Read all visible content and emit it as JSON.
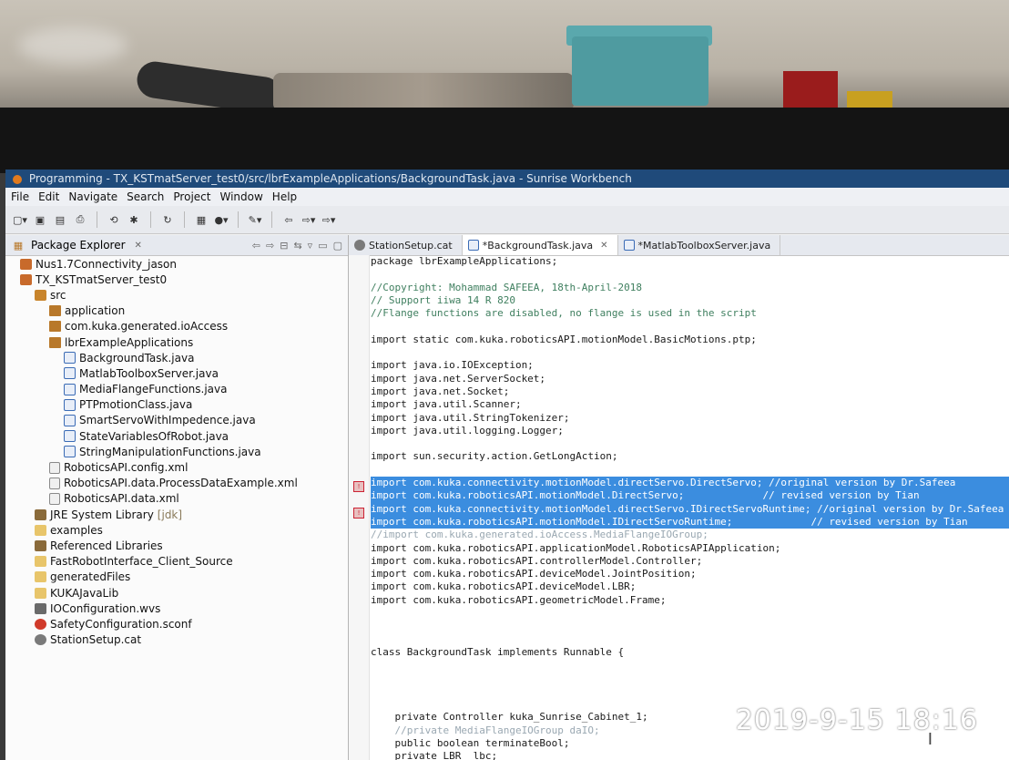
{
  "window": {
    "title": "Programming - TX_KSTmatServer_test0/src/lbrExampleApplications/BackgroundTask.java - Sunrise Workbench"
  },
  "menu": [
    "File",
    "Edit",
    "Navigate",
    "Search",
    "Project",
    "Window",
    "Help"
  ],
  "explorer": {
    "title": "Package Explorer",
    "items": [
      {
        "label": "Nus1.7Connectivity_jason",
        "indent": 1,
        "icon": "project-icon"
      },
      {
        "label": "TX_KSTmatServer_test0",
        "indent": 1,
        "icon": "project-icon"
      },
      {
        "label": "src",
        "indent": 2,
        "icon": "src-folder-icon"
      },
      {
        "label": "application",
        "indent": 3,
        "icon": "package-icon"
      },
      {
        "label": "com.kuka.generated.ioAccess",
        "indent": 3,
        "icon": "package-icon"
      },
      {
        "label": "lbrExampleApplications",
        "indent": 3,
        "icon": "package-icon"
      },
      {
        "label": "BackgroundTask.java",
        "indent": 4,
        "icon": "java-file-icon"
      },
      {
        "label": "MatlabToolboxServer.java",
        "indent": 4,
        "icon": "java-file-icon"
      },
      {
        "label": "MediaFlangeFunctions.java",
        "indent": 4,
        "icon": "java-file-icon"
      },
      {
        "label": "PTPmotionClass.java",
        "indent": 4,
        "icon": "java-file-icon"
      },
      {
        "label": "SmartServoWithImpedence.java",
        "indent": 4,
        "icon": "java-file-icon"
      },
      {
        "label": "StateVariablesOfRobot.java",
        "indent": 4,
        "icon": "java-file-icon"
      },
      {
        "label": "StringManipulationFunctions.java",
        "indent": 4,
        "icon": "java-file-icon"
      },
      {
        "label": "RoboticsAPI.config.xml",
        "indent": 3,
        "icon": "xml-file-icon"
      },
      {
        "label": "RoboticsAPI.data.ProcessDataExample.xml",
        "indent": 3,
        "icon": "xml-file-icon"
      },
      {
        "label": "RoboticsAPI.data.xml",
        "indent": 3,
        "icon": "xml-file-icon"
      },
      {
        "label": "JRE System Library",
        "suffix": "[jdk]",
        "indent": 2,
        "icon": "library-icon"
      },
      {
        "label": "examples",
        "indent": 2,
        "icon": "folder-icon"
      },
      {
        "label": "Referenced Libraries",
        "indent": 2,
        "icon": "library-icon"
      },
      {
        "label": "FastRobotInterface_Client_Source",
        "indent": 2,
        "icon": "folder-icon"
      },
      {
        "label": "generatedFiles",
        "indent": 2,
        "icon": "folder-icon"
      },
      {
        "label": "KUKAJavaLib",
        "indent": 2,
        "icon": "folder-icon"
      },
      {
        "label": "IOConfiguration.wvs",
        "indent": 2,
        "icon": "io-config-icon"
      },
      {
        "label": "SafetyConfiguration.sconf",
        "indent": 2,
        "icon": "safety-config-icon"
      },
      {
        "label": "StationSetup.cat",
        "indent": 2,
        "icon": "station-setup-icon"
      }
    ]
  },
  "tabs": [
    {
      "label": "StationSetup.cat",
      "icon": "cat"
    },
    {
      "label": "*BackgroundTask.java",
      "icon": "java",
      "active": true
    },
    {
      "label": "*MatlabToolboxServer.java",
      "icon": "java"
    }
  ],
  "code": [
    {
      "t": "package lbrExampleApplications;"
    },
    {
      "t": ""
    },
    {
      "t": "//Copyright: Mohammad SAFEEA, 18th-April-2018",
      "c": "cm"
    },
    {
      "t": "// Support iiwa 14 R 820",
      "c": "cm"
    },
    {
      "t": "//Flange functions are disabled, no flange is used in the script",
      "c": "cm"
    },
    {
      "t": ""
    },
    {
      "t": "import static com.kuka.roboticsAPI.motionModel.BasicMotions.ptp;"
    },
    {
      "t": ""
    },
    {
      "t": "import java.io.IOException;"
    },
    {
      "t": "import java.net.ServerSocket;"
    },
    {
      "t": "import java.net.Socket;"
    },
    {
      "t": "import java.util.Scanner;"
    },
    {
      "t": "import java.util.StringTokenizer;"
    },
    {
      "t": "import java.util.logging.Logger;"
    },
    {
      "t": ""
    },
    {
      "t": "import sun.security.action.GetLongAction;"
    },
    {
      "t": ""
    },
    {
      "t": "import com.kuka.connectivity.motionModel.directServo.DirectServo; //original version by Dr.Safeea",
      "sel": true
    },
    {
      "t": "import com.kuka.roboticsAPI.motionModel.DirectServo;             // revised version by Tian",
      "sel": true
    },
    {
      "t": "import com.kuka.connectivity.motionModel.directServo.IDirectServoRuntime; //original version by Dr.Safeea",
      "sel": true
    },
    {
      "t": "import com.kuka.roboticsAPI.motionModel.IDirectServoRuntime;             // revised version by Tian",
      "sel": true
    },
    {
      "t": "//import com.kuka.generated.ioAccess.MediaFlangeIOGroup;",
      "c": "cm-dim"
    },
    {
      "t": "import com.kuka.roboticsAPI.applicationModel.RoboticsAPIApplication;"
    },
    {
      "t": "import com.kuka.roboticsAPI.controllerModel.Controller;"
    },
    {
      "t": "import com.kuka.roboticsAPI.deviceModel.JointPosition;"
    },
    {
      "t": "import com.kuka.roboticsAPI.deviceModel.LBR;"
    },
    {
      "t": "import com.kuka.roboticsAPI.geometricModel.Frame;"
    },
    {
      "t": ""
    },
    {
      "t": ""
    },
    {
      "t": ""
    },
    {
      "t": "class BackgroundTask implements Runnable {"
    },
    {
      "t": ""
    },
    {
      "t": ""
    },
    {
      "t": ""
    },
    {
      "t": ""
    },
    {
      "t": "    private Controller kuka_Sunrise_Cabinet_1;"
    },
    {
      "t": "    //private MediaFlangeIOGroup daIO;",
      "c": "cm-dim"
    },
    {
      "t": "    public boolean terminateBool;"
    },
    {
      "t": "    private LBR  lbc;"
    }
  ],
  "timestamp": "2019-9-15  18:16"
}
